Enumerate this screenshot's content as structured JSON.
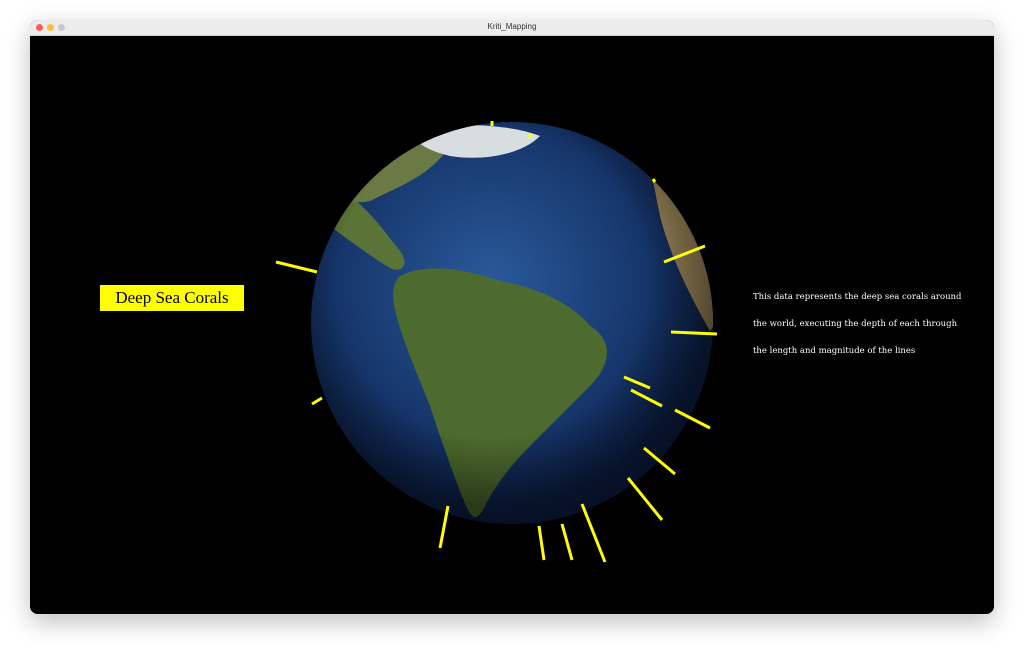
{
  "window": {
    "title": "Kriti_Mapping",
    "controls": {
      "close_color": "#ff5f57",
      "minimize_color": "#febc2e",
      "zoom_color": "#c8c8c8"
    }
  },
  "overlay": {
    "label": "Deep Sea Corals",
    "description": [
      "This data represents the deep sea corals around",
      "the world, executing the depth of each through",
      "the length and magnitude of the lines"
    ]
  },
  "colors": {
    "marker": "#ffff00",
    "label_bg": "#ffff00",
    "ocean": "#1c3f7a",
    "land": "#4a6a2c"
  }
}
